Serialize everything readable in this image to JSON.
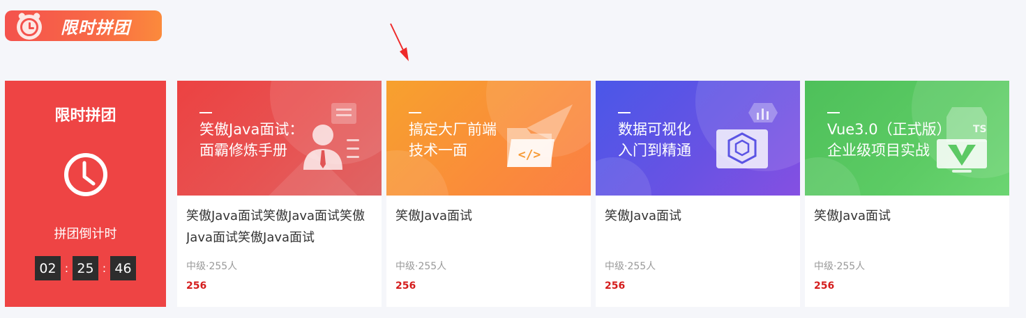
{
  "header": {
    "title": "限时拼团",
    "icon": "alarm-clock-icon"
  },
  "countdown": {
    "title": "限时拼团",
    "icon": "clock-icon",
    "label": "拼团倒计时",
    "hours": "02",
    "minutes": "25",
    "seconds": "46",
    "separator": ":"
  },
  "colors": {
    "accent": "#ee4444",
    "price": "#d41c1c"
  },
  "cards": [
    {
      "banner_line1": "笑傲Java面试：",
      "banner_line2": "面霸修炼手册",
      "title": "笑傲Java面试笑傲Java面试笑傲Java面试笑傲Java面试",
      "meta": "中级·255人",
      "price": "256",
      "icon": "interviewer-icon"
    },
    {
      "banner_line1": "搞定大厂前端",
      "banner_line2": "技术一面",
      "title": "笑傲Java面试",
      "meta": "中级·255人",
      "price": "256",
      "icon": "code-folder-icon"
    },
    {
      "banner_line1": "数据可视化",
      "banner_line2": "入门到精通",
      "title": "笑傲Java面试",
      "meta": "中级·255人",
      "price": "256",
      "icon": "data-cube-icon"
    },
    {
      "banner_line1": "Vue3.0（正式版）",
      "banner_line2": "企业级项目实战",
      "title": "笑傲Java面试",
      "meta": "中级·255人",
      "price": "256",
      "icon": "vue-monitor-icon"
    }
  ]
}
